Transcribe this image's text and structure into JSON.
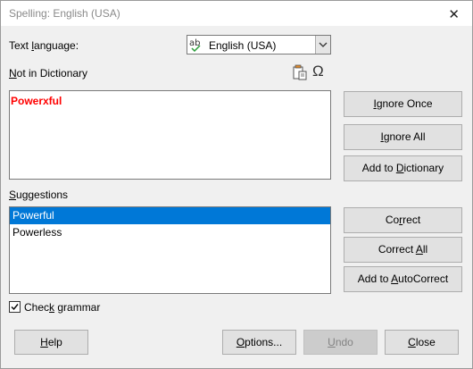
{
  "window": {
    "title": "Spelling: English (USA)",
    "close_icon": "close-icon"
  },
  "language": {
    "label_prefix": "Text ",
    "label_underlined": "l",
    "label_suffix": "anguage:",
    "selected": "English (USA)"
  },
  "not_in_dictionary": {
    "label_underlined": "N",
    "label_rest": "ot in Dictionary",
    "word": "Powerxful",
    "icons": [
      "paste-icon",
      "special-character-icon"
    ]
  },
  "suggestions": {
    "label_underlined": "S",
    "label_rest": "uggestions",
    "items": [
      "Powerful",
      "Powerless"
    ],
    "selected_index": 0
  },
  "check_grammar": {
    "label_prefix": "Chec",
    "label_underlined": "k",
    "label_suffix": " grammar",
    "checked": true
  },
  "buttons": {
    "ignore_once": {
      "pre": "",
      "u": "I",
      "post": "gnore Once"
    },
    "ignore_all": {
      "pre": "",
      "u": "I",
      "post": "gnore All"
    },
    "add_to_dictionary": {
      "pre": "Add to ",
      "u": "D",
      "post": "ictionary"
    },
    "correct": {
      "pre": "Co",
      "u": "r",
      "post": "rect"
    },
    "correct_all": {
      "pre": "Correct ",
      "u": "A",
      "post": "ll"
    },
    "add_to_autocorrect": {
      "pre": "Add to ",
      "u": "A",
      "post": "utoCorrect"
    },
    "help": {
      "pre": "",
      "u": "H",
      "post": "elp"
    },
    "options": {
      "pre": "",
      "u": "O",
      "post": "ptions..."
    },
    "undo": {
      "pre": "",
      "u": "U",
      "post": "ndo"
    },
    "close": {
      "pre": "",
      "u": "C",
      "post": "lose"
    }
  }
}
